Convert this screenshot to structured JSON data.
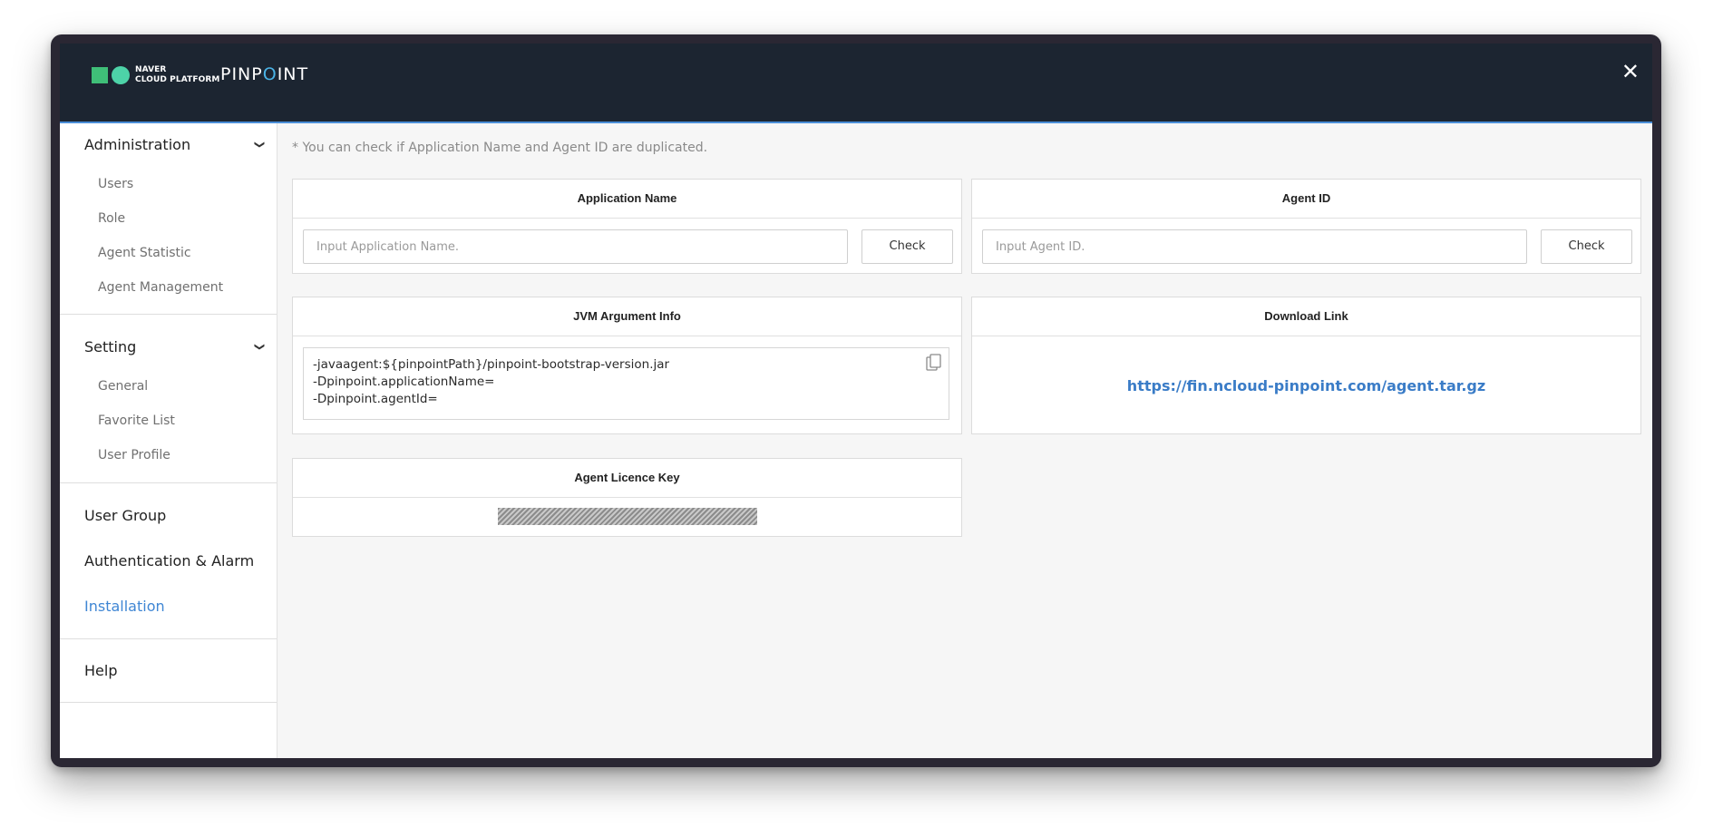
{
  "titlebar": {
    "brand_line1": "NAVER",
    "brand_line2": "CLOUD PLATFORM",
    "product_pre": "PINP",
    "product_o": "O",
    "product_post": "INT",
    "close_icon": "close-icon"
  },
  "sidebar": {
    "administration": {
      "label": "Administration",
      "items": [
        "Users",
        "Role",
        "Agent Statistic",
        "Agent Management"
      ]
    },
    "setting": {
      "label": "Setting",
      "items": [
        "General",
        "Favorite List",
        "User Profile"
      ]
    },
    "user_group": "User Group",
    "auth_alarm": "Authentication & Alarm",
    "installation": "Installation",
    "help": "Help"
  },
  "main": {
    "note": "* You can check if Application Name and Agent ID are duplicated.",
    "app_name": {
      "title": "Application Name",
      "placeholder": "Input Application Name.",
      "button": "Check"
    },
    "agent_id": {
      "title": "Agent ID",
      "placeholder": "Input Agent ID.",
      "button": "Check"
    },
    "jvm": {
      "title": "JVM Argument Info",
      "lines": [
        "-javaagent:${pinpointPath}/pinpoint-bootstrap-version.jar",
        "-Dpinpoint.applicationName=",
        "-Dpinpoint.agentId="
      ],
      "copy_icon": "copy-icon"
    },
    "download": {
      "title": "Download Link",
      "url": "https://fin.ncloud-pinpoint.com/agent.tar.gz"
    },
    "licence": {
      "title": "Agent Licence Key"
    }
  },
  "colors": {
    "accent": "#3f86d4",
    "titlebar": "#1c2531",
    "link": "#3a7cc7"
  }
}
